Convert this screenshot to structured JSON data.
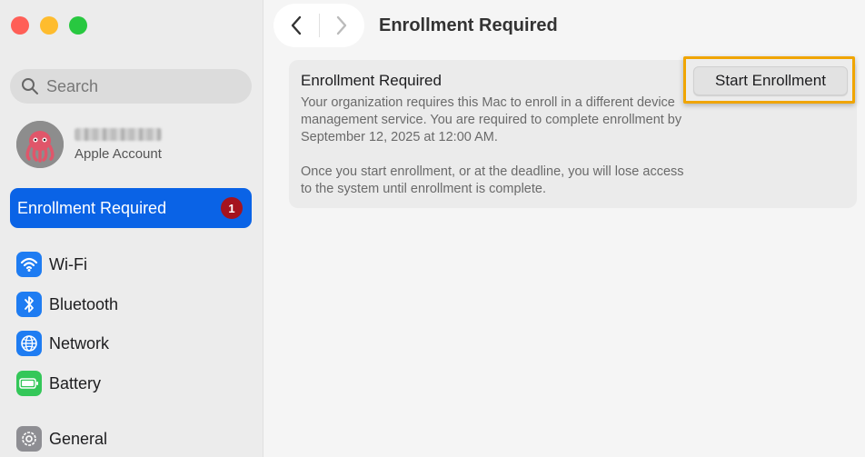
{
  "sidebar": {
    "search_placeholder": "Search",
    "account_label": "Apple Account",
    "active_item": {
      "label": "Enrollment Required",
      "badge": "1"
    },
    "items": [
      {
        "label": "Wi-Fi",
        "icon": "wifi-icon"
      },
      {
        "label": "Bluetooth",
        "icon": "bluetooth-icon"
      },
      {
        "label": "Network",
        "icon": "globe-icon"
      },
      {
        "label": "Battery",
        "icon": "battery-icon"
      },
      {
        "label": "General",
        "icon": "gear-icon"
      }
    ]
  },
  "toolbar": {
    "title": "Enrollment Required"
  },
  "main": {
    "card_title": "Enrollment Required",
    "body_paragraph_1": "Your organization requires this Mac to enroll in a different device management service. You are required to complete enrollment by September 12, 2025 at 12:00 AM.",
    "body_paragraph_2": "Once you start enrollment, or at the deadline, you will lose access to the system until enrollment is complete.",
    "start_button_label": "Start Enrollment"
  },
  "colors": {
    "accent": "#0a63e6",
    "badge": "#a5131e",
    "highlight": "#f0a500"
  }
}
